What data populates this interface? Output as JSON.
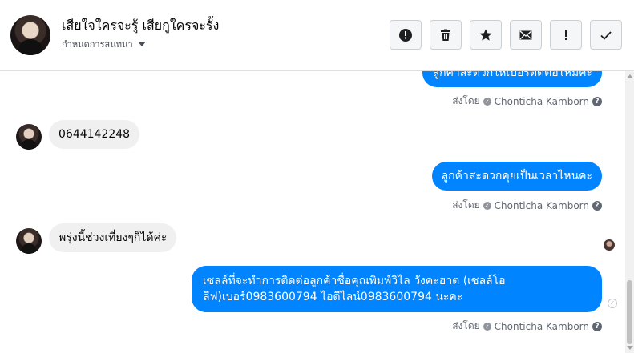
{
  "header": {
    "contact_name": "เสียใจใครจะรู้ เสียกูใครจะรั้ง",
    "subtitle": "กำหนดการสนทนา",
    "actions": [
      {
        "name": "report-icon",
        "glyph": "!"
      },
      {
        "name": "trash-icon"
      },
      {
        "name": "star-icon"
      },
      {
        "name": "envelope-icon"
      },
      {
        "name": "exclamation-icon",
        "glyph": "!"
      },
      {
        "name": "checkmark-icon"
      }
    ]
  },
  "messages": [
    {
      "direction": "out",
      "text": "ลูกค้าสะดวกให้เบอร์ติดต่อไหมคะ",
      "sent_by_label": "ส่งโดย",
      "sender": "Chonticha Kamborn"
    },
    {
      "direction": "in",
      "text": "0644142248"
    },
    {
      "direction": "out",
      "text": "ลูกค้าสะดวกคุยเป็นเวลาไหนคะ",
      "sent_by_label": "ส่งโดย",
      "sender": "Chonticha Kamborn"
    },
    {
      "direction": "in",
      "text": "พรุ่งนี้ช่วงเที่ยงๆก็ได้ค่ะ"
    },
    {
      "direction": "out",
      "text_line1": "เซลล์ที่จะทำการติดต่อลูกค้าชื่อคุณพิมพ์วิไล วังคะฮาต (เซลล์โอ",
      "text_line2": "ลีฟ)เบอร์0983600794 ไอดีไลน์0983600794 นะคะ",
      "sent_by_label": "ส่งโดย",
      "sender": "Chonticha Kamborn"
    }
  ],
  "colors": {
    "accent": "#0084ff",
    "incoming": "#f1f0f0"
  }
}
